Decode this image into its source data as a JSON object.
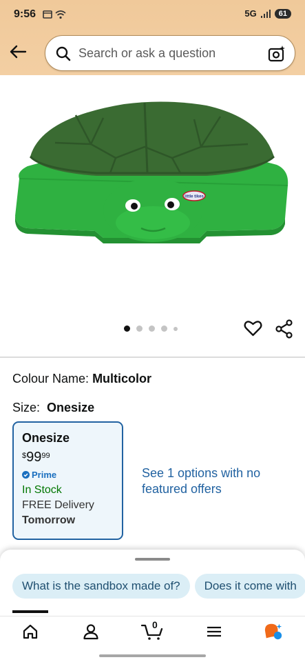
{
  "status_bar": {
    "time": "9:56",
    "network": "5G",
    "battery": "61"
  },
  "search": {
    "placeholder": "Search or ask a question"
  },
  "product": {
    "image_alt": "Green turtle sandbox",
    "logo_text": "little tikes",
    "carousel": {
      "count": 5,
      "active": 0
    }
  },
  "colour": {
    "label": "Colour Name:",
    "value": "Multicolor"
  },
  "size": {
    "label": "Size:",
    "value": "Onesize"
  },
  "variant_card": {
    "title": "Onesize",
    "price_symbol": "$",
    "price_whole": "99",
    "price_fraction": "99",
    "prime_label": "Prime",
    "stock": "In Stock",
    "delivery": "FREE Delivery",
    "delivery_day": "Tomorrow"
  },
  "see_options": "See 1 options with no featured offers",
  "suggestions": [
    "What is the sandbox made of?",
    "Does it come with"
  ],
  "bottom_nav": {
    "items": [
      {
        "name": "home",
        "icon": "home-icon"
      },
      {
        "name": "account",
        "icon": "person-icon"
      },
      {
        "name": "cart",
        "icon": "cart-icon",
        "count": "0"
      },
      {
        "name": "menu",
        "icon": "menu-icon"
      },
      {
        "name": "rufus",
        "icon": "rufus-icon"
      }
    ]
  },
  "colors": {
    "header": "#f0c99a",
    "link": "#2162a1",
    "in_stock": "#007600",
    "prime": "#1a6fbf",
    "chip_bg": "#dbeef6",
    "turtle_green": "#2fb141",
    "turtle_dark": "#3a6b32"
  }
}
